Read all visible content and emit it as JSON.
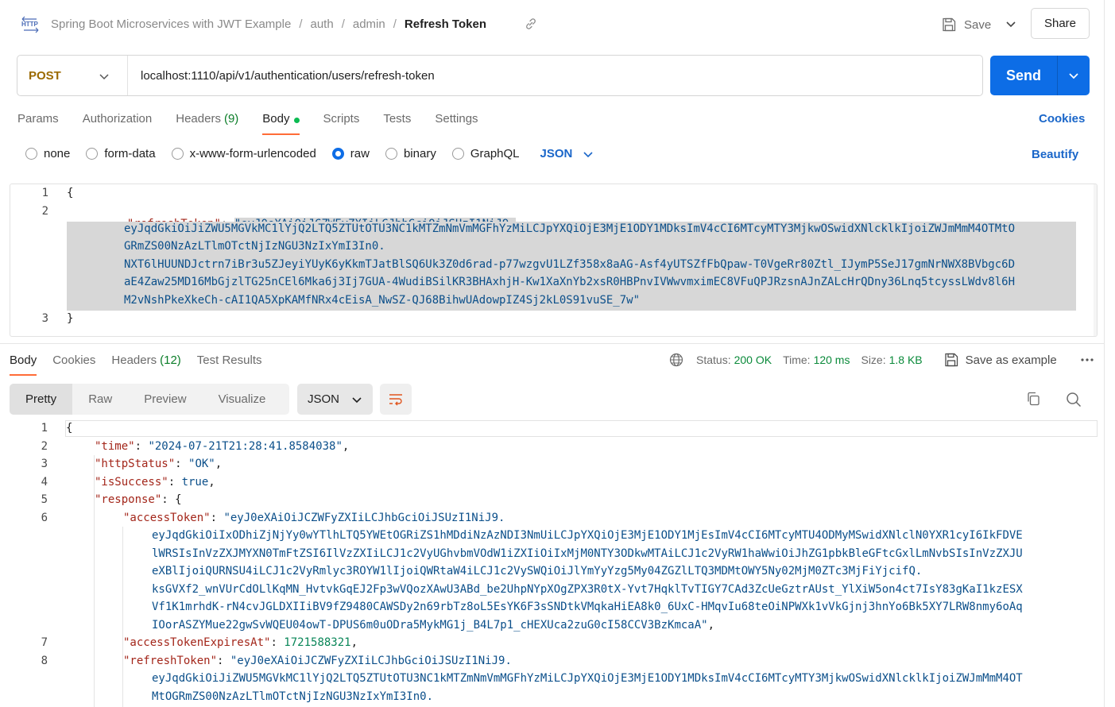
{
  "header": {
    "breadcrumb": [
      "Spring Boot Microservices with JWT Example",
      "auth",
      "admin"
    ],
    "title": "Refresh Token",
    "save_label": "Save",
    "share_label": "Share"
  },
  "request": {
    "method": "POST",
    "url": "localhost:1110/api/v1/authentication/users/refresh-token",
    "send_label": "Send"
  },
  "req_tabs": {
    "params": "Params",
    "authorization": "Authorization",
    "headers": "Headers",
    "headers_count": "(9)",
    "body": "Body",
    "scripts": "Scripts",
    "tests": "Tests",
    "settings": "Settings",
    "cookies": "Cookies"
  },
  "body_types": {
    "none": "none",
    "form_data": "form-data",
    "urlencoded": "x-www-form-urlencoded",
    "raw": "raw",
    "binary": "binary",
    "graphql": "GraphQL",
    "format": "JSON",
    "beautify": "Beautify",
    "selected": "raw"
  },
  "request_body": {
    "line_numbers": [
      "1",
      "2",
      "3"
    ],
    "open": "{",
    "key": "\"refreshToken\"",
    "colon": ": ",
    "value_lines": [
      "\"eyJ0eXAiOiJCZWFyZXIiLCJhbGciOiJSUzI1NiJ9.",
      "eyJqdGkiOiJiZWU5MGVkMC1lYjQ2LTQ5ZTUtOTU3NC1kMTZmNmVmMGFhYzMiLCJpYXQiOjE3MjE1ODY1MDksImV4cCI6MTcyMTY3MjkwOSwidXNlcklkIjoiZWJmMmM4OTMtO",
      "GRmZS00NzAzLTlmOTctNjIzNGU3NzIxYmI3In0.",
      "NXT6lHUUNDJctrn7iBr3u5ZJeyiYUyK6yKkmTJatBlSQ6Uk3Z0d6rad-p77wzgvU1LZf358x8aAG-Asf4yUTSZfFbQpaw-T0VgeRr80Ztl_IJymP5SeJ17gmNrNWX8BVbgc6D",
      "aE4Zaw25MD16MbGjzlTG25nCEl6Mka6j3Ij7GUA-4WudiBSilKR3BHAxhjH-Kw1XaXnYb2xsR0HBPnvIVWwvmximEC8VFuQPJRzsnAJnZALcHrQDny36Lnq5tcyssLWdv8l6H",
      "M2vNshPkeXkeCh-cAI1QA5XpKAMfNRx4cEisA_NwSZ-QJ68BihwUAdowpIZ4Sj2kL0S91vuSE_7w\""
    ],
    "close": "}"
  },
  "response_tabs": {
    "body": "Body",
    "cookies": "Cookies",
    "headers": "Headers",
    "headers_count": "(12)",
    "test_results": "Test Results"
  },
  "response_meta": {
    "status_label": "Status:",
    "status_value": "200 OK",
    "time_label": "Time:",
    "time_value": "120 ms",
    "size_label": "Size:",
    "size_value": "1.8 KB",
    "save_example": "Save as example"
  },
  "view_modes": {
    "pretty": "Pretty",
    "raw": "Raw",
    "preview": "Preview",
    "visualize": "Visualize",
    "format": "JSON"
  },
  "response_body": {
    "line_numbers": [
      "1",
      "2",
      "3",
      "4",
      "5",
      "6",
      "7",
      "8"
    ],
    "open": "{",
    "time_key": "\"time\"",
    "time_value": "\"2024-07-21T21:28:41.8584038\"",
    "httpStatus_key": "\"httpStatus\"",
    "httpStatus_value": "\"OK\"",
    "isSuccess_key": "\"isSuccess\"",
    "isSuccess_value": "true",
    "response_key": "\"response\"",
    "response_open": "{",
    "accessToken_key": "\"accessToken\"",
    "accessToken_lines": [
      "\"eyJ0eXAiOiJCZWFyZXIiLCJhbGciOiJSUzI1NiJ9.",
      "eyJqdGkiOiIxODhiZjNjYy0wYTlhLTQ5YWEtOGRiZS1hMDdiNzAzNDI3NmUiLCJpYXQiOjE3MjE1ODY1MjEsImV4cCI6MTcyMTU4ODMyMSwidXNlclN0YXR1cyI6IkFDVE",
      "lWRSIsInVzZXJMYXN0TmFtZSI6IlVzZXIiLCJ1c2VyUGhvbmVOdW1iZXIiOiIxMjM0NTY3ODkwMTAiLCJ1c2VyRW1haWwiOiJhZG1pbkBleGFtcGxlLmNvbSIsInVzZXJU",
      "eXBlIjoiQURNSU4iLCJ1c2VyRmlyc3ROYW1lIjoiQWRtaW4iLCJ1c2VySWQiOiJlYmYyYzg5My04ZGZlLTQ3MDMtOWY5Ny02MjM0ZTc3MjFiYjcifQ.",
      "ksGVXf2_wnVUrCdOLlKqMN_HvtvkGqEJ2Fp3wVQozXAwU3ABd_be2UhpNYpXOgZPX3R0tX-Yvt7HqklTvTIGY7CAd3ZcUeGztrAUst_YlXiW5on4ct7IsY83gKaI1kzESX",
      "Vf1K1mrhdK-rN4cvJGLDXIIiBV9fZ9480CAWSDy2n69rbTz8oL5EsYK6F3sSNDtkVMqkaHiEA8k0_6UxC-HMqvIu68teOiNPWXk1vVkGjnj3hnYo6Bk5XY7LRW8nmy6oAq",
      "IOorASZYMue22gwSvWQEU04owT-DPUS6m0uODra5MykMG1j_B4L7p1_cHEXUca2zuG0cI58CCV3BzKmcaA\""
    ],
    "accessTokenExpiresAt_key": "\"accessTokenExpiresAt\"",
    "accessTokenExpiresAt_value": "1721588321",
    "refreshToken_key": "\"refreshToken\"",
    "refreshToken_lines": [
      "\"eyJ0eXAiOiJCZWFyZXIiLCJhbGciOiJSUzI1NiJ9.",
      "eyJqdGkiOiJiZWU5MGVkMC1lYjQ2LTQ5ZTUtOTU3NC1kMTZmNmVmMGFhYzMiLCJpYXQiOjE3MjE1ODY1MDksImV4cCI6MTcyMTY3MjkwOSwidXNlcklkIjoiZWJmMmM4OT",
      "MtOGRmZS00NzAzLTlmOTctNjIzNGU3NzIxYmI3In0."
    ]
  },
  "colors": {
    "accent": "#0d6de6",
    "tab_underline": "#ff6c37",
    "status_ok": "#0a8a3a",
    "method_post": "#9b6a00"
  }
}
